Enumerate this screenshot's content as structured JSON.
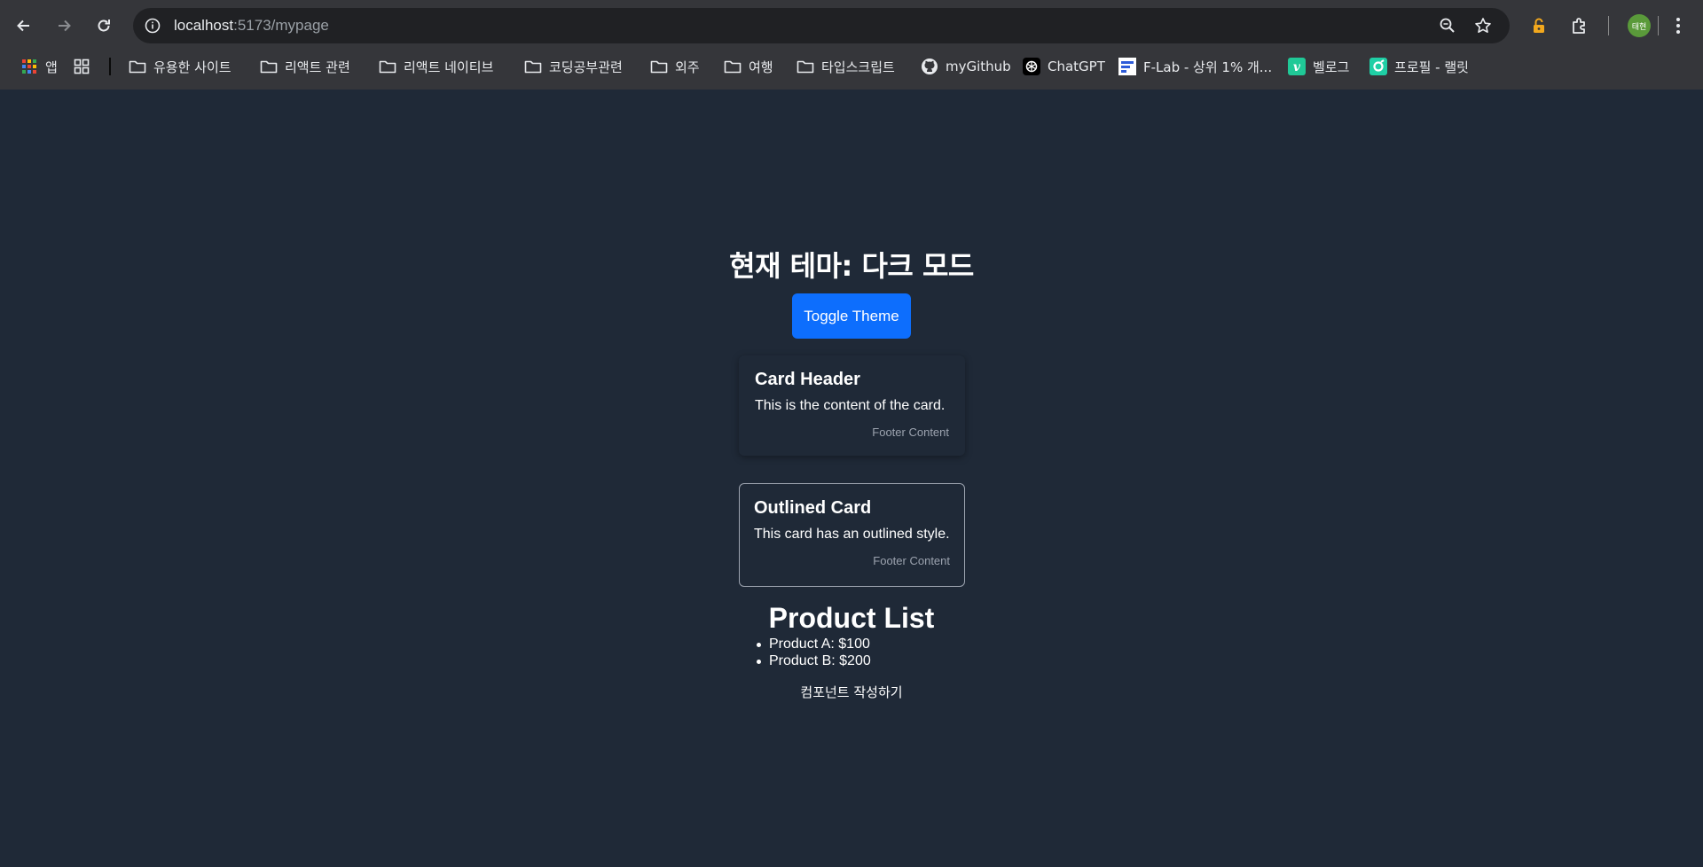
{
  "browser": {
    "url_host": "localhost",
    "url_path": ":5173/mypage",
    "avatar_text": "태현",
    "bookmarks": [
      {
        "label": "앱",
        "icon": "apps-grid-icon"
      },
      {
        "label": "",
        "icon": "tab-groups-icon"
      },
      {
        "label": "유용한 사이트",
        "icon": "folder-icon"
      },
      {
        "label": "리액트 관련",
        "icon": "folder-icon"
      },
      {
        "label": "리액트 네이티브",
        "icon": "folder-icon"
      },
      {
        "label": "코딩공부관련",
        "icon": "folder-icon"
      },
      {
        "label": "외주",
        "icon": "folder-icon"
      },
      {
        "label": "여행",
        "icon": "folder-icon"
      },
      {
        "label": "타입스크립트",
        "icon": "folder-icon"
      },
      {
        "label": "myGithub",
        "icon": "github-icon"
      },
      {
        "label": "ChatGPT",
        "icon": "chatgpt-icon"
      },
      {
        "label": "F-Lab - 상위 1% 개...",
        "icon": "flab-icon"
      },
      {
        "label": "벨로그",
        "icon": "velog-icon"
      },
      {
        "label": "프로필 - 랠릿",
        "icon": "rallit-icon"
      }
    ]
  },
  "page": {
    "theme_title": "현재 테마: 다크 모드",
    "toggle_label": "Toggle Theme",
    "card": {
      "header": "Card Header",
      "content": "This is the content of the card.",
      "footer": "Footer Content"
    },
    "outlined_card": {
      "header": "Outlined Card",
      "content": "This card has an outlined style.",
      "footer": "Footer Content"
    },
    "product_title": "Product List",
    "products": [
      "Product A: $100",
      "Product B: $200"
    ],
    "write_component": "컴포넌트 작성하기"
  },
  "colors": {
    "page_bg": "#1f2937",
    "button_bg": "#0d6efd",
    "chrome_bg": "#35363a"
  }
}
